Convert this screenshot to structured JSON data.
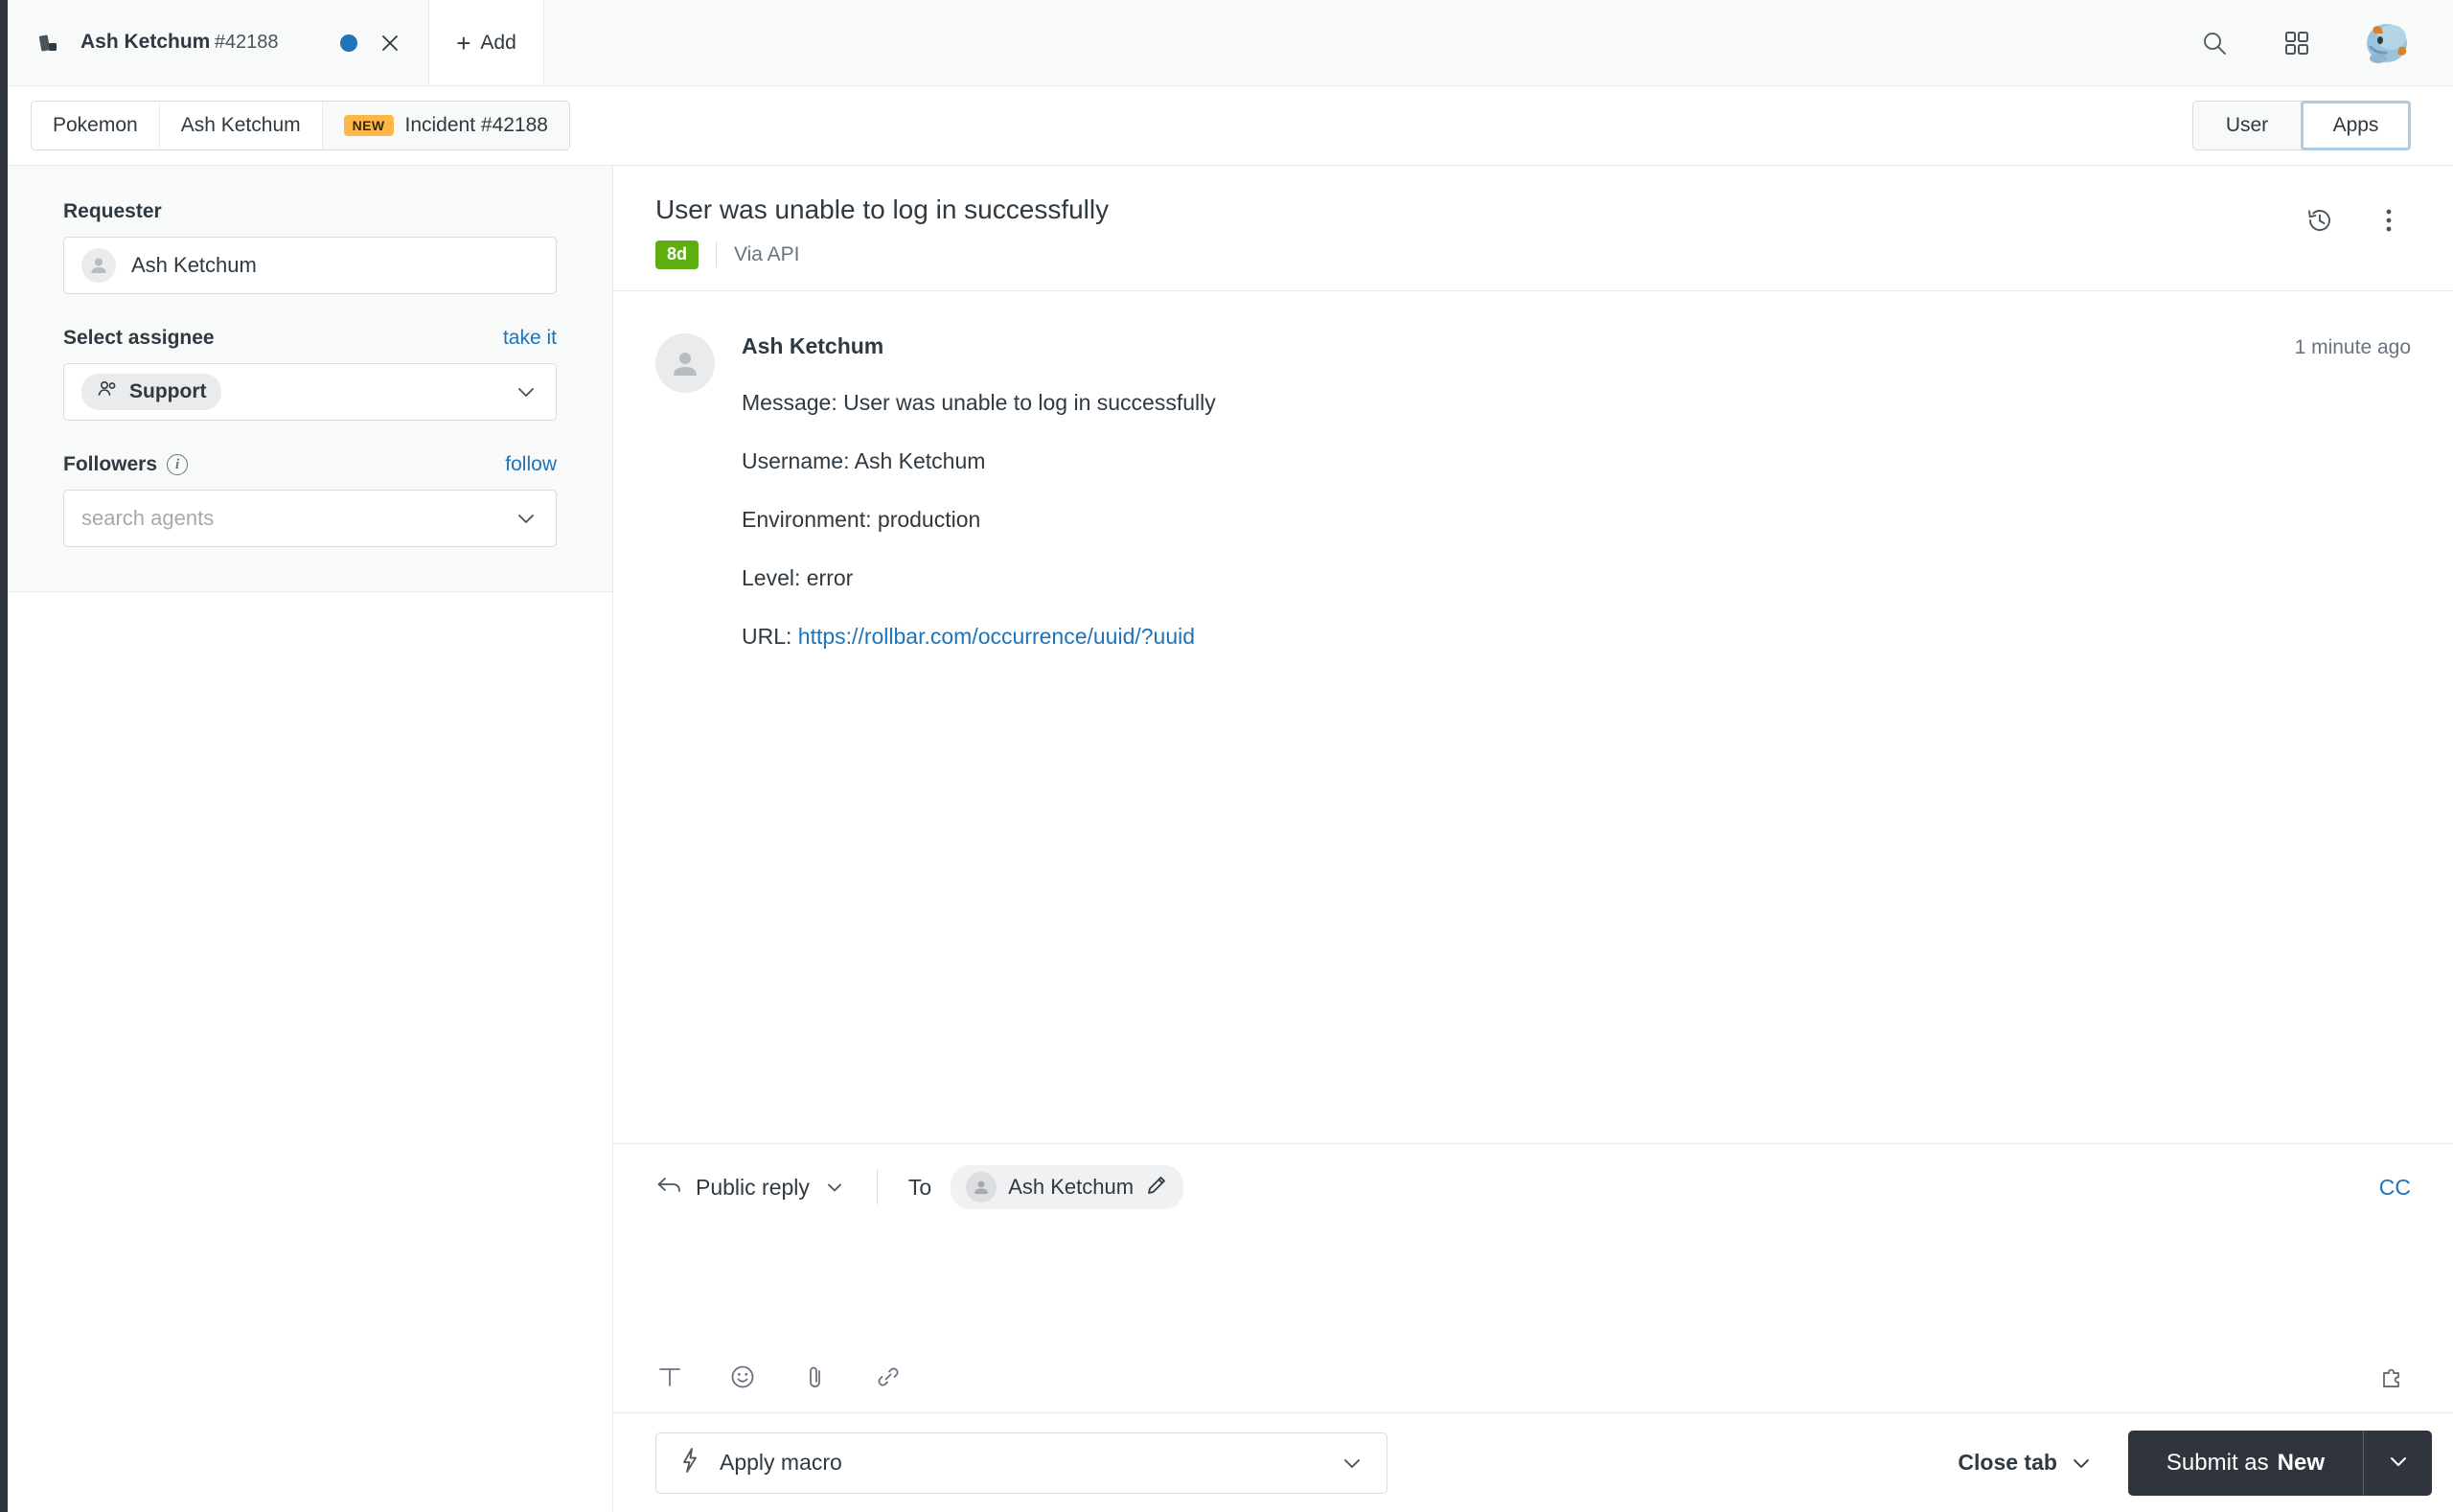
{
  "topbar": {
    "tab": {
      "title": "Ash Ketchum",
      "ticket_number": "#42188",
      "unsaved_icon": "blue-dot-icon",
      "close_icon": "close-icon"
    },
    "add_label": "Add",
    "search_icon": "search-icon",
    "grid_icon": "grid-apps-icon",
    "avatar": "user-avatar"
  },
  "breadcrumb": {
    "items": [
      {
        "label": "Pokemon",
        "badge": ""
      },
      {
        "label": "Ash Ketchum",
        "badge": ""
      },
      {
        "label": "Incident #42188",
        "badge": "NEW"
      }
    ]
  },
  "panel_toggle": {
    "options": [
      "User",
      "Apps"
    ],
    "selected": "Apps"
  },
  "sidebar": {
    "requester": {
      "label": "Requester",
      "value": "Ash Ketchum"
    },
    "assignee": {
      "label": "Select assignee",
      "action_label": "take it",
      "value": "Support"
    },
    "followers": {
      "label": "Followers",
      "action_label": "follow",
      "placeholder": "search agents",
      "info_icon": "info-icon"
    }
  },
  "ticket": {
    "subject": "User was unable to log in successfully",
    "age_badge": "8d",
    "channel": "Via API",
    "history_icon": "history-clock-icon",
    "menu_icon": "more-vertical-icon"
  },
  "comment": {
    "author": "Ash Ketchum",
    "timestamp": "1 minute ago",
    "lines": [
      "Message: User was unable to log in successfully",
      "Username: Ash Ketchum",
      "Environment: production",
      "Level: error"
    ],
    "url_prefix": "URL: ",
    "url_text": "https://rollbar.com/occurrence/uuid/?uuid"
  },
  "composer": {
    "reply_type": "Public reply",
    "to_label": "To",
    "recipient": "Ash Ketchum",
    "cc_label": "CC",
    "tools": [
      {
        "name": "text-format-icon"
      },
      {
        "name": "emoji-icon"
      },
      {
        "name": "attachment-icon"
      },
      {
        "name": "link-icon"
      }
    ],
    "apps_icon": "puzzle-piece-icon"
  },
  "footer": {
    "macro_label": "Apply macro",
    "macro_icon": "lightning-bolt-icon",
    "close_tab_label": "Close tab",
    "submit_prefix": "Submit as ",
    "submit_state": "New"
  },
  "colors": {
    "accent_blue": "#1f73b7",
    "badge_new": "#ffb648",
    "badge_days": "#5eae0f",
    "submit_dark": "#30353d"
  }
}
